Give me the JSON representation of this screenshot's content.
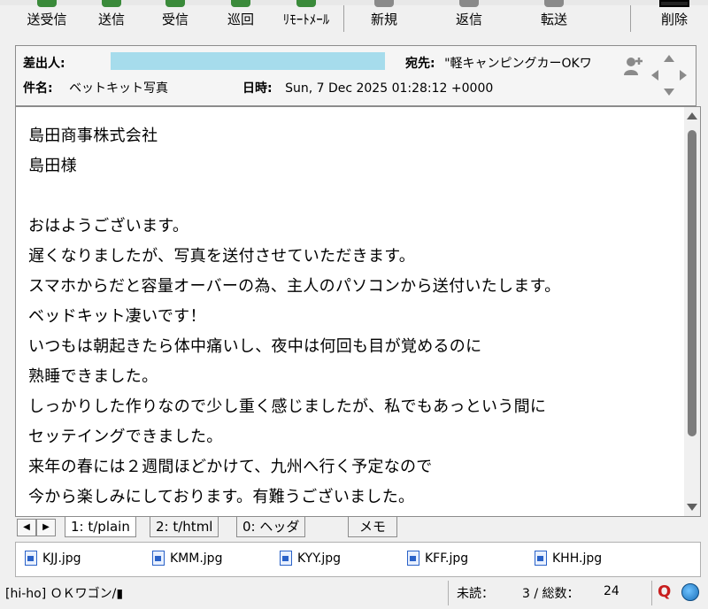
{
  "toolbar": {
    "buttons": [
      {
        "label": "送受信",
        "color": "#3a8a3a"
      },
      {
        "label": "送信",
        "color": "#3a8a3a"
      },
      {
        "label": "受信",
        "color": "#3a8a3a"
      },
      {
        "label": "巡回",
        "color": "#3a8a3a"
      },
      {
        "label": "ﾘﾓｰﾄﾒｰﾙ",
        "color": "#3a8a3a"
      },
      {
        "label": "新規",
        "color": "#707070"
      },
      {
        "label": "返信",
        "color": "#707070"
      },
      {
        "label": "転送",
        "color": "#707070"
      },
      {
        "label": "削除",
        "color": "#707070"
      }
    ]
  },
  "header": {
    "from_label": "差出人:",
    "to_label": "宛先:",
    "to_value": "\"軽キャンピングカーOKワ",
    "subject_label": "件名:",
    "subject_value": "ベットキット写真",
    "date_label": "日時:",
    "date_value": "Sun, 7 Dec 2025 01:28:12 +0000"
  },
  "body": {
    "lines": [
      "島田商事株式会社",
      "島田様",
      "",
      "おはようございます。",
      "遅くなりましたが、写真を送付させていただきます。",
      "スマホからだと容量オーバーの為、主人のパソコンから送付いたします。",
      "ベッドキット凄いです！",
      "いつもは朝起きたら体中痛いし、夜中は何回も目が覚めるのに",
      "熟睡できました。",
      "しっかりした作りなので少し重く感じましたが、私でもあっという間に",
      "セッテイングできました。",
      "来年の春には２週間ほどかけて、九州へ行く予定なので",
      "今から楽しみにしております。有難うございました。"
    ]
  },
  "tabs": [
    {
      "label": "1: t/plain"
    },
    {
      "label": "2: t/html"
    },
    {
      "label": "0: ヘッダ"
    },
    {
      "label": "メモ"
    }
  ],
  "attachments": [
    {
      "name": "KJJ.jpg"
    },
    {
      "name": "KMM.jpg"
    },
    {
      "name": "KYY.jpg"
    },
    {
      "name": "KFF.jpg"
    },
    {
      "name": "KHH.jpg"
    }
  ],
  "status": {
    "folder": "[hi-ho] ＯＫワゴン/▮",
    "unread_label": "未読：",
    "unread_value": "3 / 総数：",
    "total_value": "24",
    "q_label": "Q"
  }
}
